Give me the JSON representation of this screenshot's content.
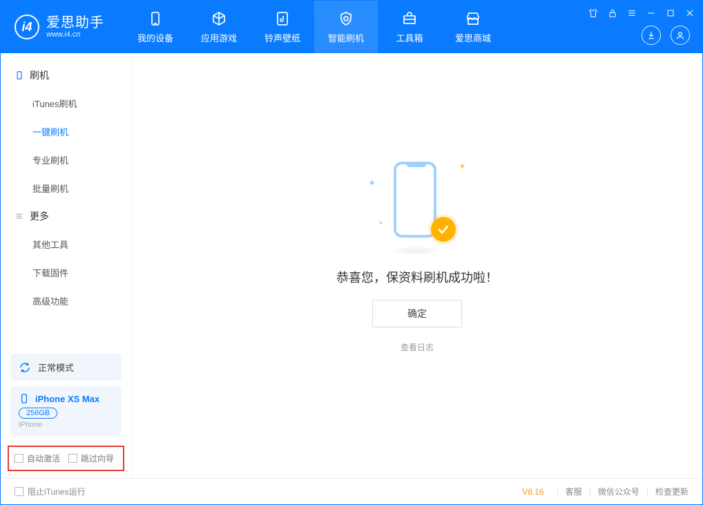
{
  "app": {
    "name_cn": "爱思助手",
    "name_en": "www.i4.cn"
  },
  "nav": [
    {
      "label": "我的设备"
    },
    {
      "label": "应用游戏"
    },
    {
      "label": "铃声壁纸"
    },
    {
      "label": "智能刷机"
    },
    {
      "label": "工具箱"
    },
    {
      "label": "爱思商城"
    }
  ],
  "sidebar": {
    "flash_header": "刷机",
    "flash_items": [
      {
        "label": "iTunes刷机"
      },
      {
        "label": "一键刷机"
      },
      {
        "label": "专业刷机"
      },
      {
        "label": "批量刷机"
      }
    ],
    "more_header": "更多",
    "more_items": [
      {
        "label": "其他工具"
      },
      {
        "label": "下载固件"
      },
      {
        "label": "高级功能"
      }
    ]
  },
  "mode": {
    "label": "正常模式"
  },
  "device": {
    "name": "iPhone XS Max",
    "storage": "256GB",
    "type": "iPhone"
  },
  "options": {
    "auto_activate": "自动激活",
    "skip_guide": "跳过向导"
  },
  "main": {
    "success_title": "恭喜您，保资料刷机成功啦！",
    "confirm": "确定",
    "view_log": "查看日志"
  },
  "footer": {
    "block_itunes": "阻止iTunes运行",
    "version": "V8.16",
    "support": "客服",
    "wechat": "微信公众号",
    "update": "检查更新"
  }
}
